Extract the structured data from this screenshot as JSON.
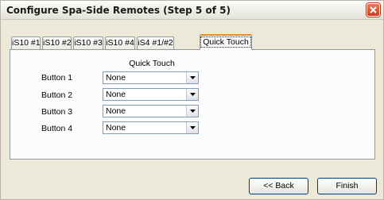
{
  "window": {
    "title": "Configure Spa-Side Remotes (Step 5 of 5)"
  },
  "tabs": [
    {
      "label": "iS10 #1"
    },
    {
      "label": "iS10 #2"
    },
    {
      "label": "iS10 #3"
    },
    {
      "label": "iS10 #4"
    },
    {
      "label": "iS4 #1/#2"
    },
    {
      "label": "Quick Touch"
    }
  ],
  "panel": {
    "section_title": "Quick Touch",
    "rows": [
      {
        "label": "Button 1",
        "value": "None"
      },
      {
        "label": "Button 2",
        "value": "None"
      },
      {
        "label": "Button 3",
        "value": "None"
      },
      {
        "label": "Button 4",
        "value": "None"
      }
    ]
  },
  "footer": {
    "back_label": "<< Back",
    "finish_label": "Finish"
  },
  "icons": {
    "close": "close-icon",
    "dropdown": "chevron-down-icon"
  },
  "colors": {
    "close_button": "#c8401c",
    "active_tab_accent": "#e68b2c",
    "window_bg": "#ece9d8"
  }
}
